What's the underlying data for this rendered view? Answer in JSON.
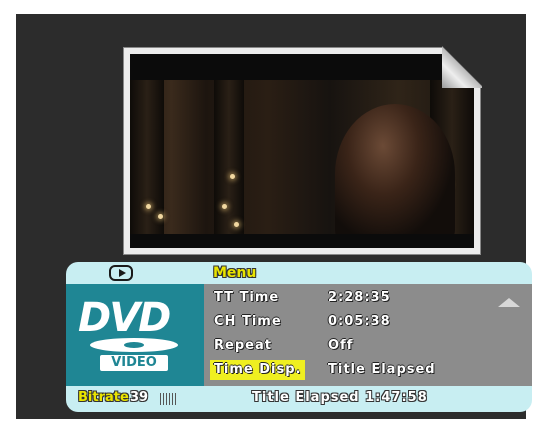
{
  "menu": {
    "title": "Menu"
  },
  "logo": {
    "brand": "DVD",
    "sub": "VIDEO"
  },
  "settings": [
    {
      "label": "TT Time",
      "value": "2:28:35",
      "selected": false
    },
    {
      "label": "CH Time",
      "value": "0:05:38",
      "selected": false
    },
    {
      "label": "Repeat",
      "value": "Off",
      "selected": false
    },
    {
      "label": "Time Disp.",
      "value": "Title Elapsed",
      "selected": true
    }
  ],
  "status": {
    "bitrate_label": "Bitrate",
    "bitrate_value": "39",
    "time_display": "Title Elapsed 1:47:58"
  },
  "icons": {
    "play": "play-icon",
    "scroll_up": "scroll-up-icon"
  },
  "colors": {
    "panel": "#c8eef2",
    "accent_yellow": "#e9e400",
    "logo_bg": "#1f8694",
    "list_bg": "#8c8c8c"
  }
}
